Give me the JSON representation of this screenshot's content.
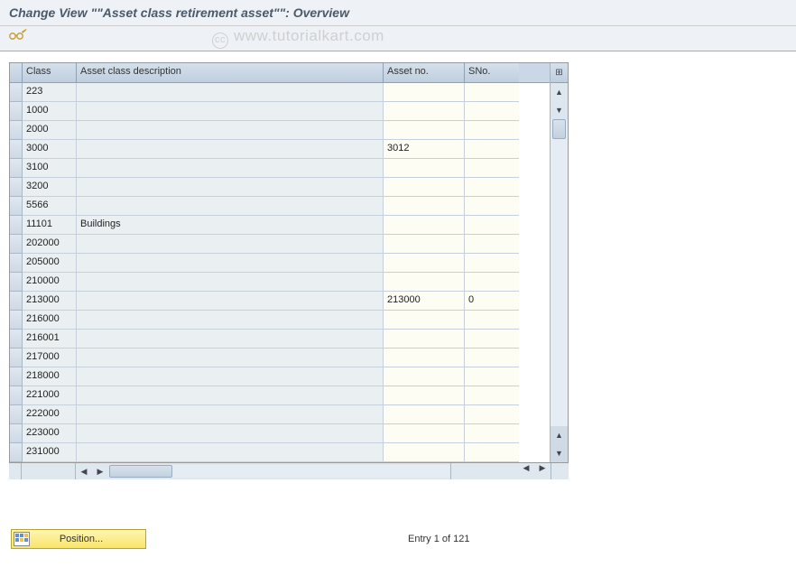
{
  "page_title": "Change View \"\"Asset class retirement asset\"\": Overview",
  "watermark": "www.tutorialkart.com",
  "columns": {
    "class": "Class",
    "desc": "Asset class description",
    "asset": "Asset no.",
    "sno": "SNo."
  },
  "config_btn_label": "⊞",
  "rows": [
    {
      "class": "223",
      "desc": "",
      "asset": "",
      "sno": ""
    },
    {
      "class": "1000",
      "desc": "",
      "asset": "",
      "sno": ""
    },
    {
      "class": "2000",
      "desc": "",
      "asset": "",
      "sno": ""
    },
    {
      "class": "3000",
      "desc": "",
      "asset": "3012",
      "sno": ""
    },
    {
      "class": "3100",
      "desc": "",
      "asset": "",
      "sno": ""
    },
    {
      "class": "3200",
      "desc": "",
      "asset": "",
      "sno": ""
    },
    {
      "class": "5566",
      "desc": "",
      "asset": "",
      "sno": ""
    },
    {
      "class": "11101",
      "desc": "Buildings",
      "asset": "",
      "sno": ""
    },
    {
      "class": "202000",
      "desc": "",
      "asset": "",
      "sno": ""
    },
    {
      "class": "205000",
      "desc": "",
      "asset": "",
      "sno": ""
    },
    {
      "class": "210000",
      "desc": "",
      "asset": "",
      "sno": ""
    },
    {
      "class": "213000",
      "desc": "",
      "asset": "213000",
      "sno": "0"
    },
    {
      "class": "216000",
      "desc": "",
      "asset": "",
      "sno": ""
    },
    {
      "class": "216001",
      "desc": "",
      "asset": "",
      "sno": ""
    },
    {
      "class": "217000",
      "desc": "",
      "asset": "",
      "sno": ""
    },
    {
      "class": "218000",
      "desc": "",
      "asset": "",
      "sno": ""
    },
    {
      "class": "221000",
      "desc": "",
      "asset": "",
      "sno": ""
    },
    {
      "class": "222000",
      "desc": "",
      "asset": "",
      "sno": ""
    },
    {
      "class": "223000",
      "desc": "",
      "asset": "",
      "sno": ""
    },
    {
      "class": "231000",
      "desc": "",
      "asset": "",
      "sno": ""
    }
  ],
  "footer": {
    "position_label": "Position...",
    "entry_text": "Entry 1 of 121"
  }
}
